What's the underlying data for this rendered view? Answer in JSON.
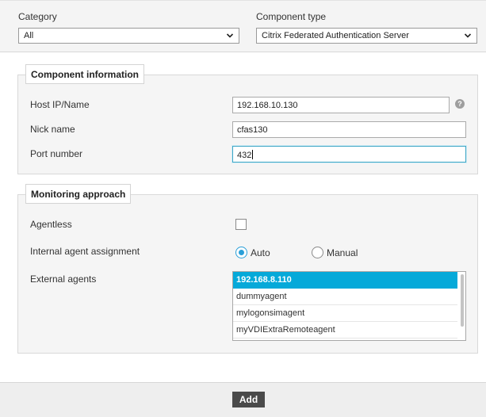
{
  "header": {
    "category_label": "Category",
    "category_value": "All",
    "component_type_label": "Component type",
    "component_type_value": "Citrix Federated Authentication Server"
  },
  "component_information": {
    "legend": "Component information",
    "host_label": "Host IP/Name",
    "host_value": "192.168.10.130",
    "help_icon": "?",
    "nick_label": "Nick name",
    "nick_value": "cfas130",
    "port_label": "Port number",
    "port_value": "432"
  },
  "monitoring_approach": {
    "legend": "Monitoring approach",
    "agentless_label": "Agentless",
    "agentless_checked": false,
    "internal_label": "Internal agent assignment",
    "internal_options": [
      {
        "label": "Auto",
        "selected": true
      },
      {
        "label": "Manual",
        "selected": false
      }
    ],
    "external_label": "External agents",
    "external_agents": [
      {
        "name": "192.168.8.110",
        "selected": true
      },
      {
        "name": "dummyagent",
        "selected": false
      },
      {
        "name": "mylogonsimagent",
        "selected": false
      },
      {
        "name": "myVDIExtraRemoteagent",
        "selected": false
      }
    ]
  },
  "footer": {
    "add_label": "Add"
  },
  "colors": {
    "accent": "#05a9d9",
    "focus_border": "#3fa6c5",
    "button_bg": "#4a4a4a"
  },
  "icons": {
    "dropdown": "chevron-down-icon",
    "help": "help-icon"
  }
}
